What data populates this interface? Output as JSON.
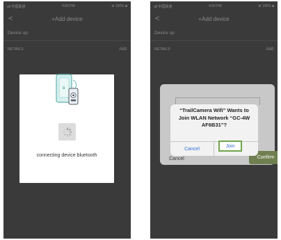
{
  "phones": {
    "left": {
      "status": {
        "left": "all 中国联通",
        "center": "4:00 PM",
        "right": "⊕ 100% ■"
      },
      "nav": {
        "back": "<",
        "title": "+Add device"
      },
      "setup_label": "Device up",
      "row": {
        "label": "RETAILS",
        "action": "Add"
      },
      "modal": {
        "message": "connecting device bluetooth"
      }
    },
    "right": {
      "status": {
        "left": "all 中国联通",
        "center": "4:00 PM",
        "right": "⊕ 100% ■"
      },
      "nav": {
        "back": "<",
        "title": "+Add device"
      },
      "setup_label": "Device up",
      "row": {
        "label": "RETAILS",
        "action": "Add"
      },
      "dialog_back": {
        "cancel": "Cancel",
        "confirm": "Confirm"
      },
      "alert": {
        "line1": "“TrailCamera Wifi” Wants to",
        "line2": "Join WLAN Network “GC-4W",
        "line3": "AF6B31”?",
        "cancel": "Cancel",
        "join": "Join"
      }
    }
  },
  "colors": {
    "background": "#3a3a3a",
    "alert_button": "#2f6fd6",
    "join_highlight": "#6fa44b",
    "confirm_button": "#6f7f4f"
  }
}
